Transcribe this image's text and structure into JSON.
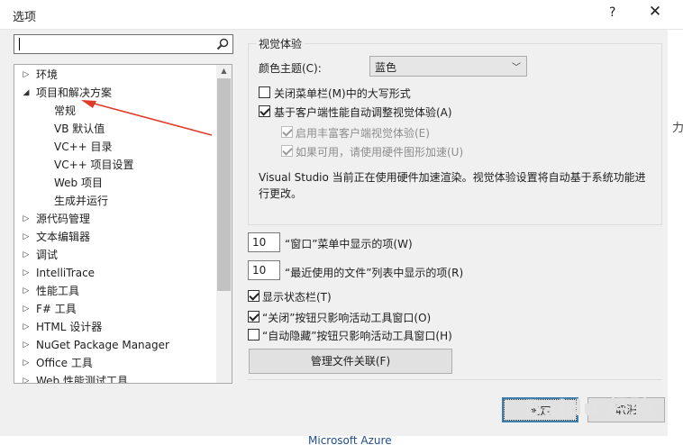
{
  "window": {
    "title": "选项",
    "help_label": "?",
    "close_label": "✕"
  },
  "search": {
    "placeholder": ""
  },
  "tree": {
    "items": [
      {
        "label": "环境",
        "level": 0,
        "arrow": "▷"
      },
      {
        "label": "项目和解决方案",
        "level": 0,
        "arrow": "◢"
      },
      {
        "label": "常规",
        "level": 1,
        "arrow": "",
        "selected": true
      },
      {
        "label": "VB 默认值",
        "level": 1,
        "arrow": ""
      },
      {
        "label": "VC++ 目录",
        "level": 1,
        "arrow": ""
      },
      {
        "label": "VC++ 项目设置",
        "level": 1,
        "arrow": ""
      },
      {
        "label": "Web 项目",
        "level": 1,
        "arrow": ""
      },
      {
        "label": "生成并运行",
        "level": 1,
        "arrow": ""
      },
      {
        "label": "源代码管理",
        "level": 0,
        "arrow": "▷"
      },
      {
        "label": "文本编辑器",
        "level": 0,
        "arrow": "▷"
      },
      {
        "label": "调试",
        "level": 0,
        "arrow": "▷"
      },
      {
        "label": "IntelliTrace",
        "level": 0,
        "arrow": "▷"
      },
      {
        "label": "性能工具",
        "level": 0,
        "arrow": "▷"
      },
      {
        "label": "F# 工具",
        "level": 0,
        "arrow": "▷"
      },
      {
        "label": "HTML 设计器",
        "level": 0,
        "arrow": "▷"
      },
      {
        "label": "NuGet Package Manager",
        "level": 0,
        "arrow": "▷"
      },
      {
        "label": "Office 工具",
        "level": 0,
        "arrow": "▷"
      },
      {
        "label": "Web 性能测试工具",
        "level": 0,
        "arrow": "▷"
      }
    ],
    "scroll_up": "▲"
  },
  "visual": {
    "group_title": "视觉体验",
    "theme_label": "颜色主题(C):",
    "theme_value": "蓝色",
    "uppercase_menu": {
      "label": "关闭菜单栏(M)中的大写形式",
      "checked": false
    },
    "auto_adjust": {
      "label": "基于客户端性能自动调整视觉体验(A)",
      "checked": true
    },
    "rich_client": {
      "label": "启用丰富客户端视觉体验(E)",
      "checked": true,
      "disabled": true
    },
    "hw_accel": {
      "label": "如果可用，请使用硬件图形加速(U)",
      "checked": true,
      "disabled": true
    },
    "description": "Visual Studio 当前正在使用硬件加速渲染。视觉体验设置将自动基于系统功能进行更改。"
  },
  "window_menu_items": {
    "value": "10",
    "label": "“窗口”菜单中显示的项(W)"
  },
  "recent_files": {
    "value": "10",
    "label": "“最近使用的文件”列表中显示的项(R)"
  },
  "status_bar": {
    "label": "显示状态栏(T)",
    "checked": true
  },
  "close_button_active": {
    "label": "“关闭”按钮只影响活动工具窗口(O)",
    "checked": true
  },
  "autohide_active": {
    "label": "“自动隐藏”按钮只影响活动工具窗口(H)",
    "checked": false
  },
  "file_assoc_button": "管理文件关联(F)",
  "ok_button": "确定",
  "cancel_button": "取消",
  "background": {
    "right_peek": "力",
    "bottom_text": "Microsoft Azure"
  },
  "watermark": "Baidu 经验"
}
